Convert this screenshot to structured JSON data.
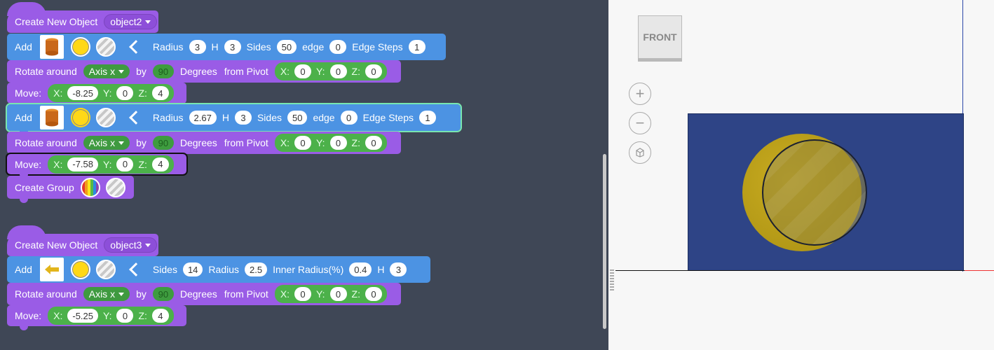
{
  "block_group_1": {
    "create": {
      "label": "Create New Object",
      "object": "object2"
    },
    "add1": {
      "label": "Add",
      "radius_label": "Radius",
      "radius": "3",
      "h_label": "H",
      "h": "3",
      "sides_label": "Sides",
      "sides": "50",
      "edge_label": "edge",
      "edge": "0",
      "edge_steps_label": "Edge Steps",
      "edge_steps": "1"
    },
    "rotate1": {
      "label": "Rotate around",
      "axis": "Axis x",
      "by": "by",
      "degrees": "90",
      "degrees_label": "Degrees",
      "pivot_label": "from Pivot",
      "x_label": "X:",
      "x": "0",
      "y_label": "Y:",
      "y": "0",
      "z_label": "Z:",
      "z": "0"
    },
    "move1": {
      "label": "Move:",
      "x_label": "X:",
      "x": "-8.25",
      "y_label": "Y:",
      "y": "0",
      "z_label": "Z:",
      "z": "4"
    },
    "add2": {
      "label": "Add",
      "radius_label": "Radius",
      "radius": "2.67",
      "h_label": "H",
      "h": "3",
      "sides_label": "Sides",
      "sides": "50",
      "edge_label": "edge",
      "edge": "0",
      "edge_steps_label": "Edge Steps",
      "edge_steps": "1"
    },
    "rotate2": {
      "label": "Rotate around",
      "axis": "Axis x",
      "by": "by",
      "degrees": "90",
      "degrees_label": "Degrees",
      "pivot_label": "from Pivot",
      "x_label": "X:",
      "x": "0",
      "y_label": "Y:",
      "y": "0",
      "z_label": "Z:",
      "z": "0"
    },
    "move2": {
      "label": "Move:",
      "x_label": "X:",
      "x": "-7.58",
      "y_label": "Y:",
      "y": "0",
      "z_label": "Z:",
      "z": "4"
    },
    "group": {
      "label": "Create Group"
    }
  },
  "block_group_2": {
    "create": {
      "label": "Create New Object",
      "object": "object3"
    },
    "add": {
      "label": "Add",
      "sides_label": "Sides",
      "sides": "14",
      "radius_label": "Radius",
      "radius": "2.5",
      "inner_label": "Inner Radius(%)",
      "inner": "0.4",
      "h_label": "H",
      "h": "3"
    },
    "rotate": {
      "label": "Rotate around",
      "axis": "Axis x",
      "by": "by",
      "degrees": "90",
      "degrees_label": "Degrees",
      "pivot_label": "from Pivot",
      "x_label": "X:",
      "x": "0",
      "y_label": "Y:",
      "y": "0",
      "z_label": "Z:",
      "z": "0"
    },
    "move": {
      "label": "Move:",
      "x_label": "X:",
      "x": "-5.25",
      "y_label": "Y:",
      "y": "0",
      "z_label": "Z:",
      "z": "4"
    }
  },
  "viewport": {
    "view_cube_label": "FRONT",
    "zoom_in": "+",
    "zoom_out": "−"
  },
  "colors": {
    "workspace_bg": "#3f4756",
    "object_block": "#9a5ce6",
    "shape_block": "#4c93e3",
    "pivot_block": "#4cb14a",
    "selected_outline": "#78e6b0",
    "shape_yellow": "#ffd817",
    "scene_box": "#2e4486"
  }
}
